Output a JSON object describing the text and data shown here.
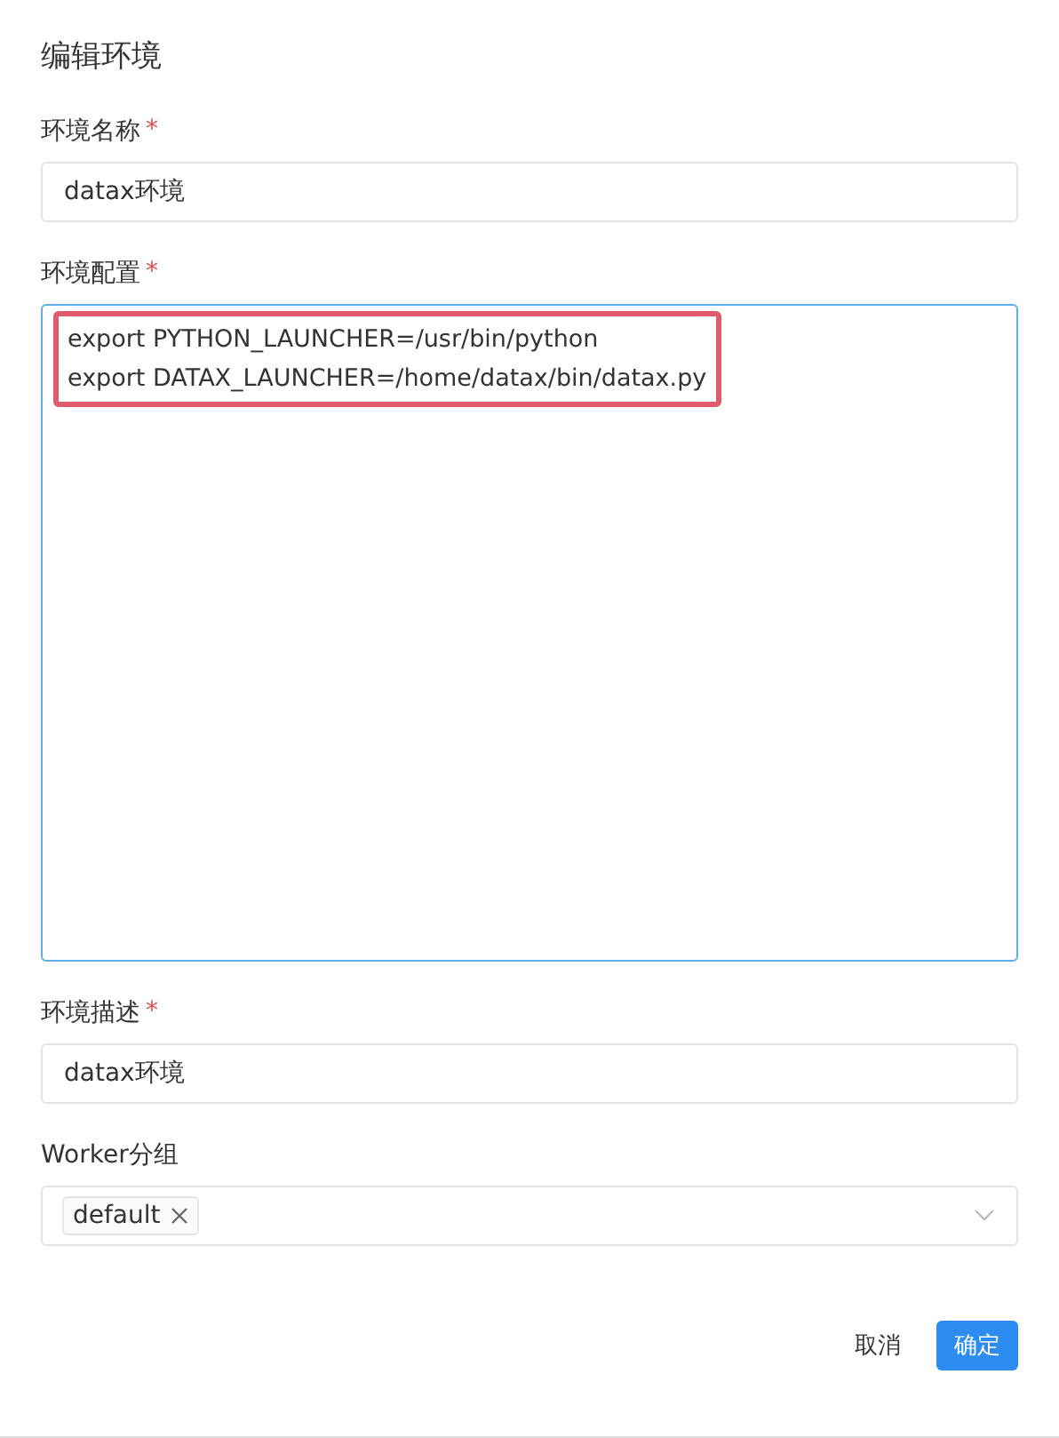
{
  "dialog": {
    "title": "编辑环境"
  },
  "fields": [
    {
      "kind": "input",
      "label": "环境名称",
      "required_mark": "*",
      "value": "datax环境"
    },
    {
      "kind": "textarea",
      "label": "环境配置",
      "required_mark": "*",
      "focused": true,
      "highlighted": true,
      "lines": [
        "export PYTHON_LAUNCHER=/usr/bin/python",
        "export DATAX_LAUNCHER=/home/datax/bin/datax.py"
      ]
    },
    {
      "kind": "input",
      "label": "环境描述",
      "required_mark": "*",
      "value": "datax环境"
    },
    {
      "kind": "select",
      "label": "Worker分组",
      "tags": [
        "default"
      ]
    }
  ],
  "buttons": [
    {
      "label": "取消",
      "primary": false
    },
    {
      "label": "确定",
      "primary": true
    }
  ]
}
